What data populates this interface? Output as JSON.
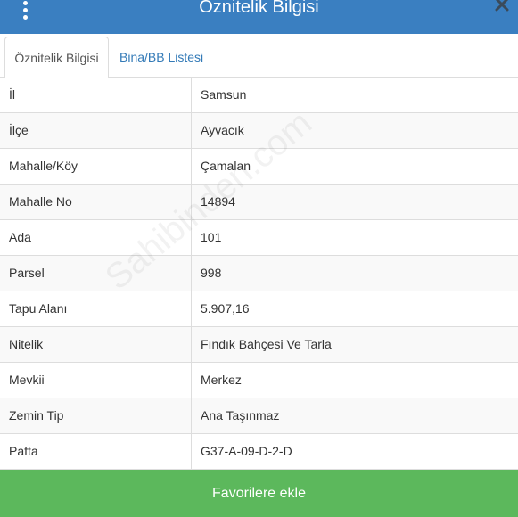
{
  "header": {
    "title": "Öznitelik Bilgisi",
    "menu_icon": "vertical-dots-icon",
    "close_icon": "close-icon"
  },
  "tabs": [
    {
      "label": "Öznitelik Bilgisi",
      "active": true
    },
    {
      "label": "Bina/BB Listesi",
      "active": false
    }
  ],
  "rows": [
    {
      "key": "İl",
      "value": "Samsun"
    },
    {
      "key": "İlçe",
      "value": "Ayvacık"
    },
    {
      "key": "Mahalle/Köy",
      "value": "Çamalan"
    },
    {
      "key": "Mahalle No",
      "value": "14894"
    },
    {
      "key": "Ada",
      "value": "101"
    },
    {
      "key": "Parsel",
      "value": "998"
    },
    {
      "key": "Tapu Alanı",
      "value": "5.907,16"
    },
    {
      "key": "Nitelik",
      "value": "Fındık Bahçesi Ve Tarla"
    },
    {
      "key": "Mevkii",
      "value": "Merkez"
    },
    {
      "key": "Zemin Tip",
      "value": "Ana Taşınmaz"
    },
    {
      "key": "Pafta",
      "value": "G37-A-09-D-2-D"
    }
  ],
  "watermark": "Sahibinden.com",
  "footer": {
    "button_label": "Favorilere ekle"
  },
  "colors": {
    "header": "#3a7fc1",
    "button": "#5cb85c",
    "link": "#337ab7"
  }
}
